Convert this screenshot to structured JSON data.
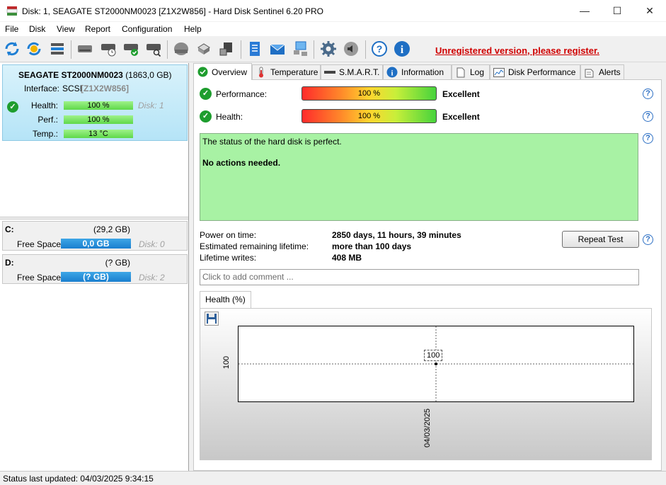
{
  "window": {
    "title": "Disk: 1, SEAGATE ST2000NM0023 [Z1X2W856]  -  Hard Disk Sentinel 6.20 PRO",
    "minimize": "—",
    "maximize": "☐",
    "close": "✕"
  },
  "menu": [
    "File",
    "Disk",
    "View",
    "Report",
    "Configuration",
    "Help"
  ],
  "toolbar": {
    "icons": [
      "refresh-icon",
      "refresh-all-icon",
      "disk-list-icon",
      "disk-icon",
      "disk-schedule-icon",
      "disk-ok-icon",
      "disk-search-icon",
      "disk-surface-icon",
      "drive-icon",
      "drive-usb-icon",
      "notepad-icon",
      "mail-icon",
      "network-icon",
      "settings-icon",
      "sound-icon",
      "help-icon",
      "info-icon"
    ],
    "register_text": "Unregistered version, please register."
  },
  "disk": {
    "name": "SEAGATE ST2000NM0023",
    "size": "(1863,0 GB)",
    "interface_label": "Interface:",
    "interface_value": "SCSI",
    "serial": "[Z1X2W856]",
    "health_label": "Health:",
    "health_value": "100 %",
    "disk_label": "Disk: 1",
    "perf_label": "Perf.:",
    "perf_value": "100 %",
    "temp_label": "Temp.:",
    "temp_value": "13 °C",
    "health_pct": 100,
    "perf_pct": 100
  },
  "volumes": [
    {
      "letter": "C:",
      "size": "(29,2 GB)",
      "free_label": "Free Space",
      "free_value": "0,0 GB",
      "disk": "Disk: 0"
    },
    {
      "letter": "D:",
      "size": "(? GB)",
      "free_label": "Free Space",
      "free_value": "(? GB)",
      "disk": "Disk: 2"
    }
  ],
  "tabs": [
    "Overview",
    "Temperature",
    "S.M.A.R.T.",
    "Information",
    "Log",
    "Disk Performance",
    "Alerts"
  ],
  "overview": {
    "performance_label": "Performance:",
    "performance_value": "100 %",
    "performance_rating": "Excellent",
    "health_label": "Health:",
    "health_value": "100 %",
    "health_rating": "Excellent",
    "status_text": "The status of the hard disk is perfect.",
    "actions_text": "No actions needed.",
    "power_on_label": "Power on time:",
    "power_on_value": "2850 days, 11 hours, 39 minutes",
    "lifetime_label": "Estimated remaining lifetime:",
    "lifetime_value": "more than 100 days",
    "writes_label": "Lifetime writes:",
    "writes_value": "408 MB",
    "repeat_test": "Repeat Test",
    "comment_placeholder": "Click to add comment ...",
    "help_symbol": "?"
  },
  "chart_tab": "Health (%)",
  "chart_data": {
    "type": "line",
    "x": [
      "04/03/2025"
    ],
    "y": [
      100
    ],
    "data_labels": [
      "100"
    ],
    "ytick_labels": [
      "100"
    ],
    "xtick_labels": [
      "04/03/2025"
    ],
    "grid": true
  },
  "statusbar": {
    "text": "Status last updated: 04/03/2025 9:34:15"
  },
  "colors": {
    "register": "#d00000",
    "status_bg": "#a8f2a4",
    "ok_green": "#1e9d2e",
    "freespace_blue": "#1a7fcf"
  }
}
